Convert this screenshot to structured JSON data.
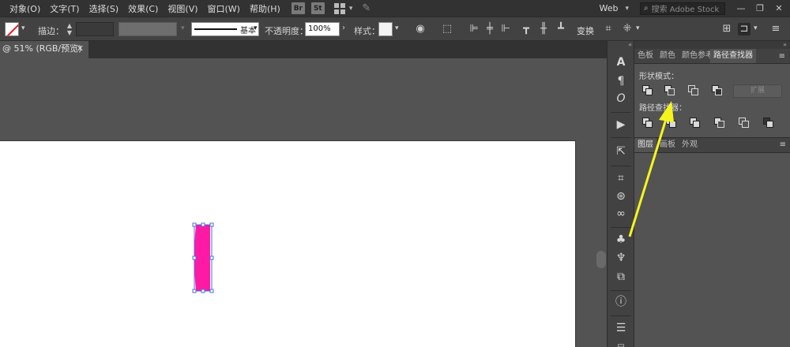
{
  "menu": {
    "items": [
      "对象(O)",
      "文字(T)",
      "选择(S)",
      "效果(C)",
      "视图(V)",
      "窗口(W)",
      "帮助(H)"
    ],
    "bridge_badge": "Br",
    "stock_badge": "St",
    "workspace": "Web",
    "search_placeholder": "搜索 Adobe Stock"
  },
  "control": {
    "stroke_label": "描边：",
    "profile_label": "基本",
    "opacity_label": "不透明度：",
    "opacity_value": "100%",
    "style_label": "样式：",
    "transform_label": "变换"
  },
  "document": {
    "tab_label": "@ 51% (RGB/预览)",
    "close_glyph": "✕"
  },
  "tools": {
    "char_glyph": "A",
    "para_glyph": "¶",
    "opentype_glyph": "O"
  },
  "panels": {
    "top_tabs": [
      "色板",
      "颜色",
      "颜色参考",
      "路径查找器"
    ],
    "active_tab": "路径查找器",
    "shape_modes_label": "形状模式：",
    "pathfinders_label": "路径查找器：",
    "expand_label": "扩展",
    "bottom_tabs": [
      "图层",
      "画板",
      "外观"
    ]
  },
  "colors": {
    "shape_fill": "#ff1aa5",
    "selection": "#4a6fe0",
    "arrow": "#f5f51c"
  }
}
